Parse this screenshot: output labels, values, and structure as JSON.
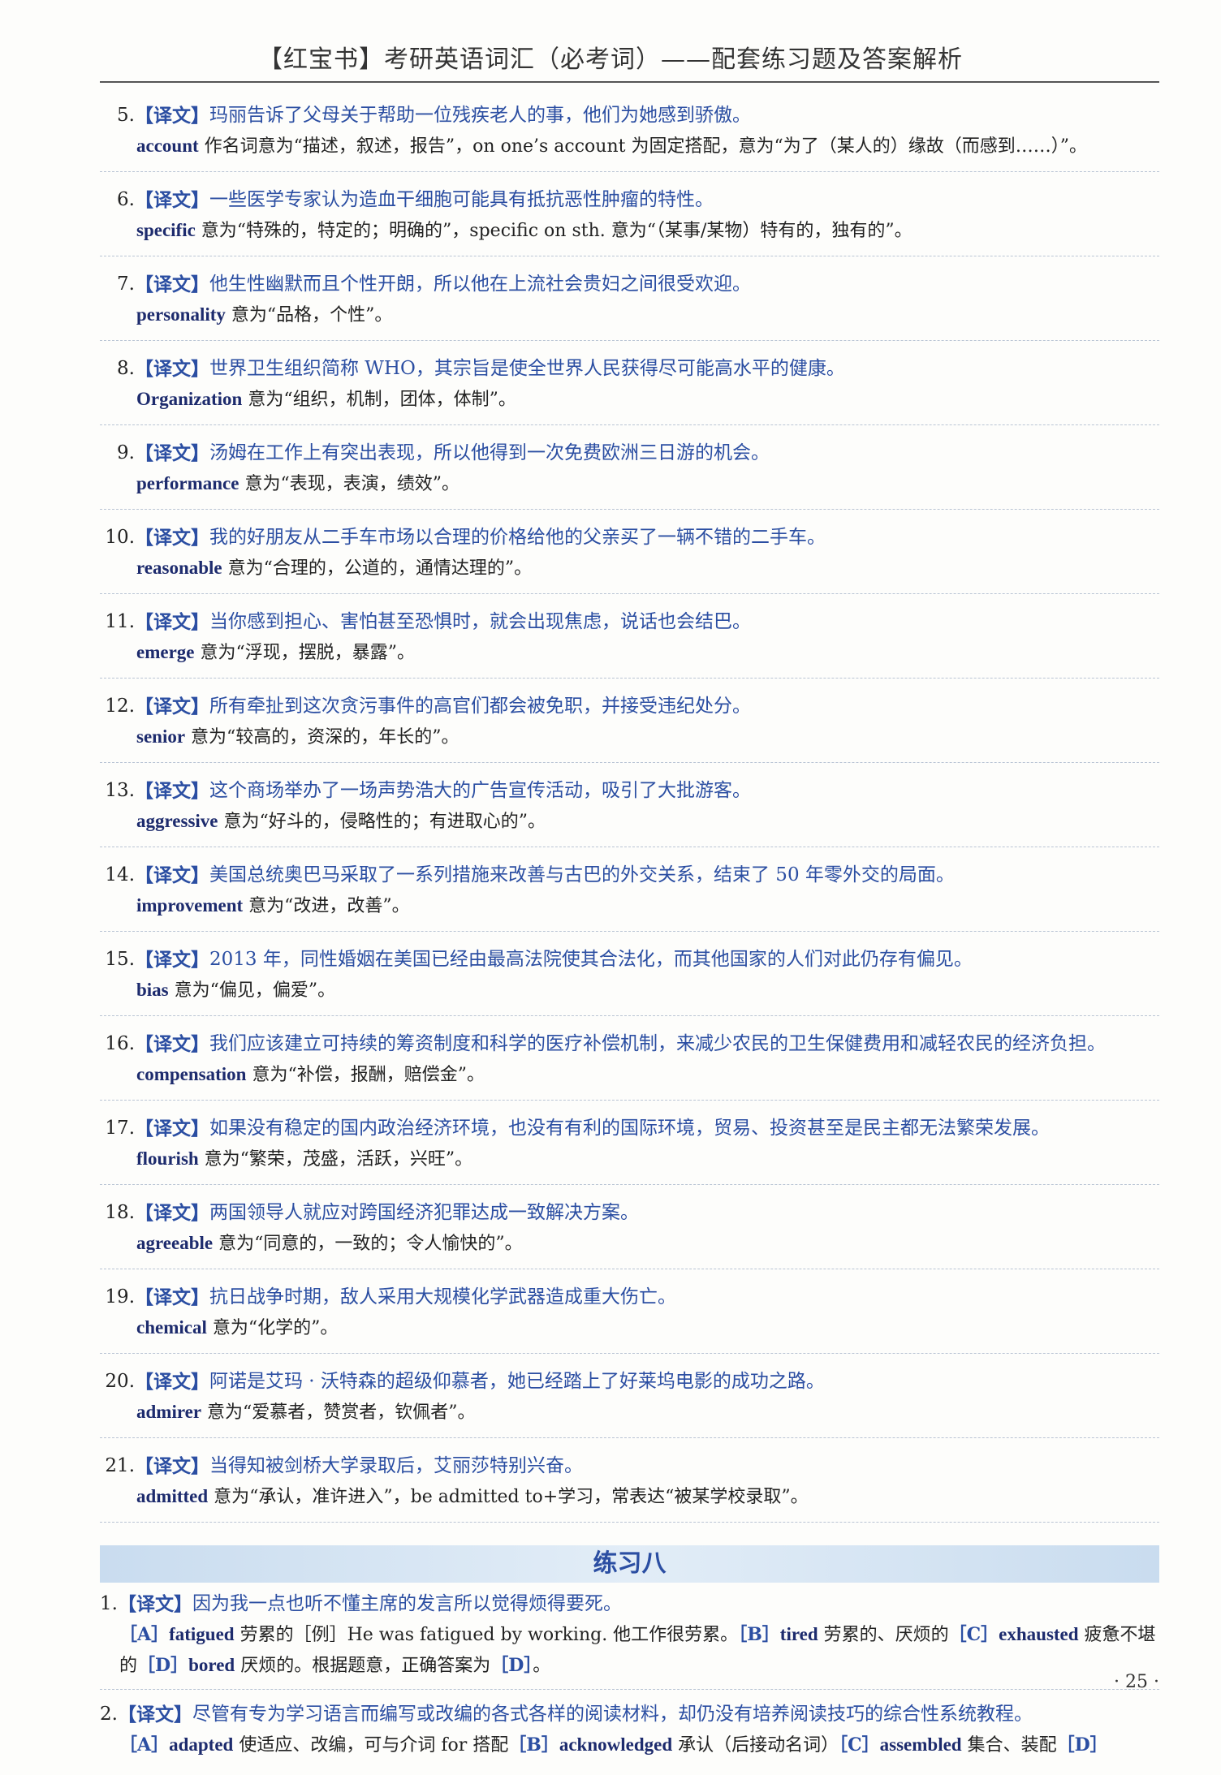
{
  "header": "【红宝书】考研英语词汇（必考词）——配套练习题及答案解析",
  "tag_label": "【译文】",
  "items": [
    {
      "num": "5.",
      "tr": "玛丽告诉了父母关于帮助一位残疾老人的事，他们为她感到骄傲。",
      "word": "account",
      "exp": " 作名词意为“描述，叙述，报告”，on one’s account 为固定搭配，意为“为了（某人的）缘故（而感到……）”。"
    },
    {
      "num": "6.",
      "tr": "一些医学专家认为造血干细胞可能具有抵抗恶性肿瘤的特性。",
      "word": "specific",
      "exp": " 意为“特殊的，特定的；明确的”，specific on sth. 意为“（某事/某物）特有的，独有的”。"
    },
    {
      "num": "7.",
      "tr": "他生性幽默而且个性开朗，所以他在上流社会贵妇之间很受欢迎。",
      "word": "personality",
      "exp": " 意为“品格，个性”。"
    },
    {
      "num": "8.",
      "tr": "世界卫生组织简称 WHO，其宗旨是使全世界人民获得尽可能高水平的健康。",
      "word": "Organization",
      "exp": " 意为“组织，机制，团体，体制”。"
    },
    {
      "num": "9.",
      "tr": "汤姆在工作上有突出表现，所以他得到一次免费欧洲三日游的机会。",
      "word": "performance",
      "exp": " 意为“表现，表演，绩效”。"
    },
    {
      "num": "10.",
      "tr": "我的好朋友从二手车市场以合理的价格给他的父亲买了一辆不错的二手车。",
      "word": "reasonable",
      "exp": " 意为“合理的，公道的，通情达理的”。"
    },
    {
      "num": "11.",
      "tr": "当你感到担心、害怕甚至恐惧时，就会出现焦虑，说话也会结巴。",
      "word": "emerge",
      "exp": " 意为“浮现，摆脱，暴露”。"
    },
    {
      "num": "12.",
      "tr": "所有牵扯到这次贪污事件的高官们都会被免职，并接受违纪处分。",
      "word": "senior",
      "exp": " 意为“较高的，资深的，年长的”。"
    },
    {
      "num": "13.",
      "tr": "这个商场举办了一场声势浩大的广告宣传活动，吸引了大批游客。",
      "word": "aggressive",
      "exp": " 意为“好斗的，侵略性的；有进取心的”。"
    },
    {
      "num": "14.",
      "tr": "美国总统奥巴马采取了一系列措施来改善与古巴的外交关系，结束了 50 年零外交的局面。",
      "word": "improvement",
      "exp": " 意为“改进，改善”。"
    },
    {
      "num": "15.",
      "tr": "2013 年，同性婚姻在美国已经由最高法院使其合法化，而其他国家的人们对此仍存有偏见。",
      "word": "bias",
      "exp": " 意为“偏见，偏爱”。"
    },
    {
      "num": "16.",
      "tr": "我们应该建立可持续的筹资制度和科学的医疗补偿机制，来减少农民的卫生保健费用和减轻农民的经济负担。",
      "word": "compensation",
      "exp": " 意为“补偿，报酬，赔偿金”。"
    },
    {
      "num": "17.",
      "tr": "如果没有稳定的国内政治经济环境，也没有有利的国际环境，贸易、投资甚至是民主都无法繁荣发展。",
      "word": "flourish",
      "exp": " 意为“繁荣，茂盛，活跃，兴旺”。"
    },
    {
      "num": "18.",
      "tr": "两国领导人就应对跨国经济犯罪达成一致解决方案。",
      "word": "agreeable",
      "exp": " 意为“同意的，一致的；令人愉快的”。"
    },
    {
      "num": "19.",
      "tr": "抗日战争时期，敌人采用大规模化学武器造成重大伤亡。",
      "word": "chemical",
      "exp": " 意为“化学的”。"
    },
    {
      "num": "20.",
      "tr": "阿诺是艾玛 · 沃特森的超级仰慕者，她已经踏上了好莱坞电影的成功之路。",
      "word": "admirer",
      "exp": " 意为“爱慕者，赞赏者，钦佩者”。"
    },
    {
      "num": "21.",
      "tr": "当得知被剑桥大学录取后，艾丽莎特别兴奋。",
      "word": "admitted",
      "exp": " 意为“承认，准许进入”，be admitted to+学习，常表达“被某学校录取”。"
    }
  ],
  "section_title": "练习八",
  "exercise": [
    {
      "num": "1.",
      "tr": "因为我一点也听不懂主席的发言所以觉得烦得要死。",
      "A": "［A］",
      "A_word": "fatigued",
      "A_text": " 劳累的［例］He was fatigued by working. 他工作很劳累。",
      "B": "［B］",
      "B_word": "tired",
      "B_text": " 劳累的、厌烦的",
      "C": "［C］",
      "C_word": "exhausted",
      "C_text": " 疲惫不堪的",
      "D": "［D］",
      "D_word": "bored",
      "D_text": " 厌烦的。根据题意，正确答案为",
      "ans": "［D］",
      "end": "。"
    },
    {
      "num": "2.",
      "tr": "尽管有专为学习语言而编写或改编的各式各样的阅读材料，却仍没有培养阅读技巧的综合性系统教程。",
      "A": "［A］",
      "A_word": "adapted",
      "A_text": " 使适应、改编，可与介词 for 搭配",
      "B": "［B］",
      "B_word": "acknowledged",
      "B_text": " 承认（后接动名词）",
      "C": "［C］",
      "C_word": "assembled",
      "C_text": " 集合、装配",
      "D": "［D］"
    }
  ],
  "page_num": "· 25 ·"
}
